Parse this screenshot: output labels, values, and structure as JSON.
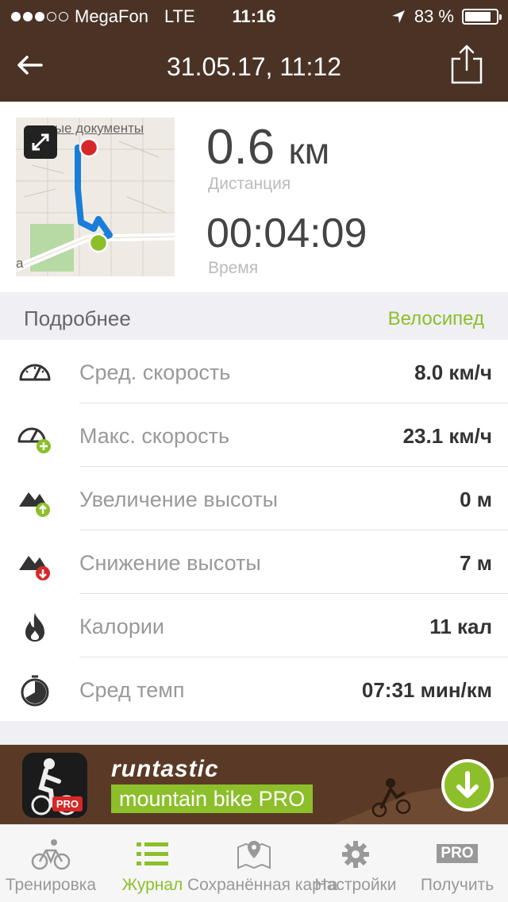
{
  "status_bar": {
    "carrier": "MegaFon",
    "network": "LTE",
    "time": "11:16",
    "battery": "83 %",
    "battery_level": 0.83,
    "signal_bars": 3,
    "signal_total": 5
  },
  "header": {
    "title": "31.05.17, 11:12",
    "back_icon": "arrow-left-icon",
    "share_icon": "share-icon"
  },
  "summary": {
    "map_label": "рные документы",
    "map_edge": "а",
    "distance_value": "0.6",
    "distance_unit": "км",
    "distance_label": "Дистанция",
    "time_value": "00:04:09",
    "time_label": "Время"
  },
  "details_section": {
    "title": "Подробнее",
    "sport": "Велосипед"
  },
  "rows": [
    {
      "label": "Сред. скорость",
      "value": "8.0 км/ч",
      "icon": "speedometer-icon"
    },
    {
      "label": "Макс. скорость",
      "value": "23.1 км/ч",
      "icon": "speedometer-plus-icon"
    },
    {
      "label": "Увеличение высоты",
      "value": "0 м",
      "icon": "elevation-gain-icon"
    },
    {
      "label": "Снижение высоты",
      "value": "7 м",
      "icon": "elevation-loss-icon"
    },
    {
      "label": "Калории",
      "value": "11 кал",
      "icon": "flame-icon"
    },
    {
      "label": "Сред темп",
      "value": "07:31 мин/км",
      "icon": "stopwatch-icon"
    }
  ],
  "banner": {
    "brand": "runtastic",
    "product": "mountain bike PRO",
    "pro_tag": "PRO"
  },
  "tabs": [
    {
      "label": "Тренировка",
      "icon": "bicycle-icon",
      "active": false
    },
    {
      "label": "Журнал",
      "icon": "list-icon",
      "active": true
    },
    {
      "label": "Сохранённая карта",
      "icon": "map-pin-icon",
      "active": false
    },
    {
      "label": "Настройки",
      "icon": "gear-icon",
      "active": false
    },
    {
      "label": "Получить",
      "icon": "pro-badge-icon",
      "active": false,
      "badge": "PRO"
    }
  ],
  "colors": {
    "header_bg": "#4a3325",
    "accent_green": "#8cbf2a",
    "route_blue": "#1a7ed8",
    "start_red": "#d62828",
    "end_green": "#8cbf2a"
  }
}
